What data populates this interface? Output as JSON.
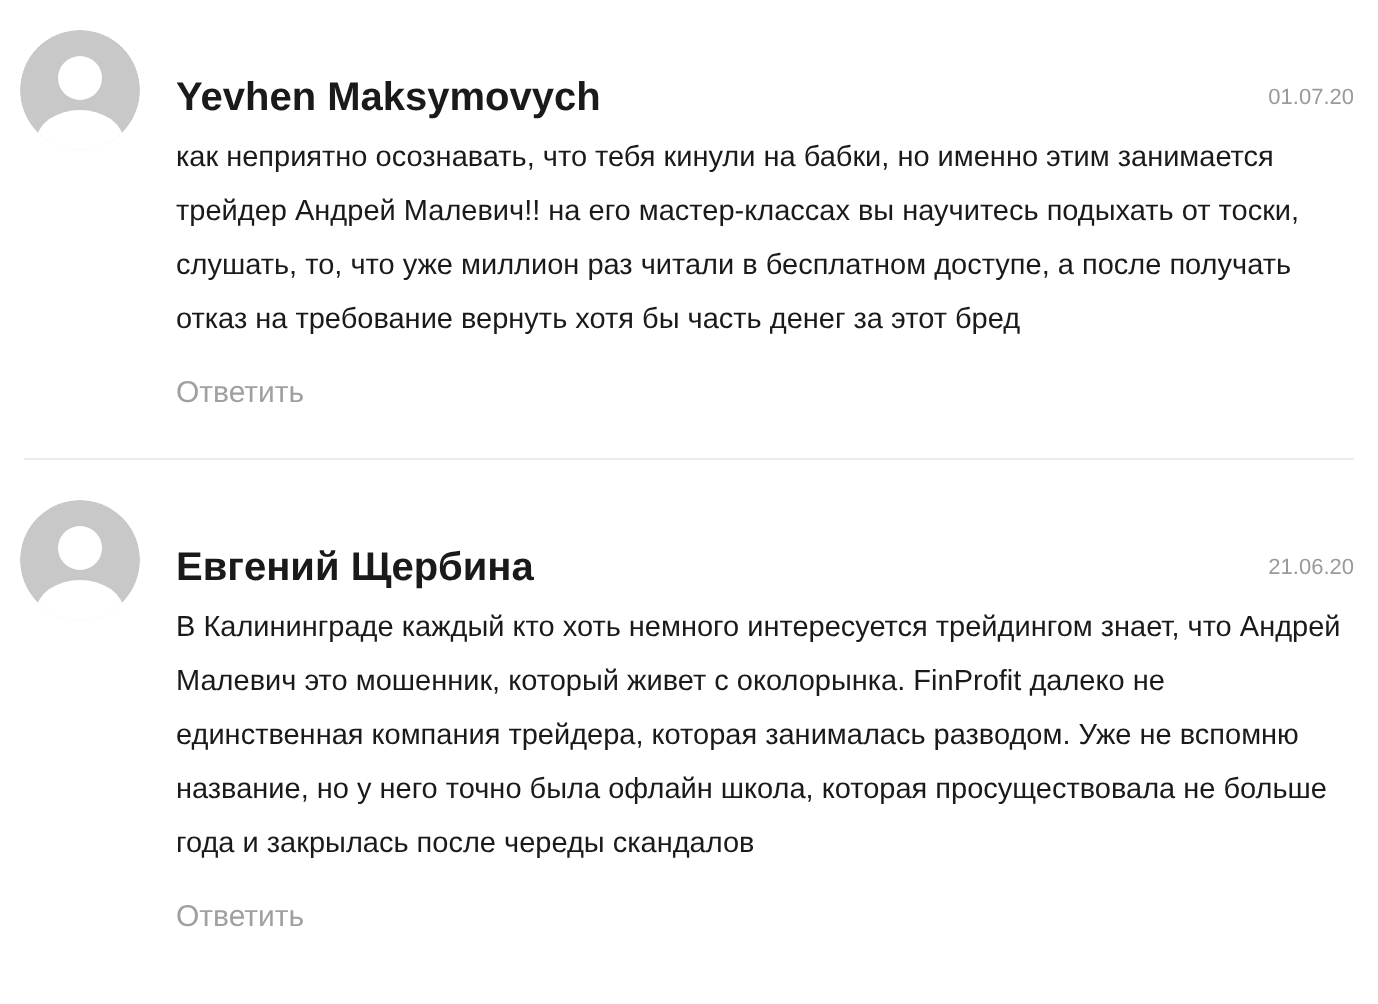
{
  "comments": [
    {
      "author": "Yevhen Maksymovych",
      "date": "01.07.20",
      "text": "как неприятно осознавать, что тебя кинули на бабки, но именно этим занимается трейдер Андрей Малевич!! на его мастер-классах вы научитесь подыхать от тоски, слушать, то, что уже миллион раз читали в бесплатном доступе, а после получать отказ на требование вернуть хотя бы часть денег за этот бред",
      "reply": "Ответить"
    },
    {
      "author": "Евгений Щербина",
      "date": "21.06.20",
      "text": "В Калининграде каждый кто хоть немного интересуется трейдингом знает, что Андрей Малевич это мошенник, который живет с околорынка. FinProfit далеко не единственная компания трейдера, которая занималась разводом. Уже не вспомню название, но у него точно была офлайн школа, которая просуществовала не больше года и закрылась после череды скандалов",
      "reply": "Ответить"
    }
  ]
}
